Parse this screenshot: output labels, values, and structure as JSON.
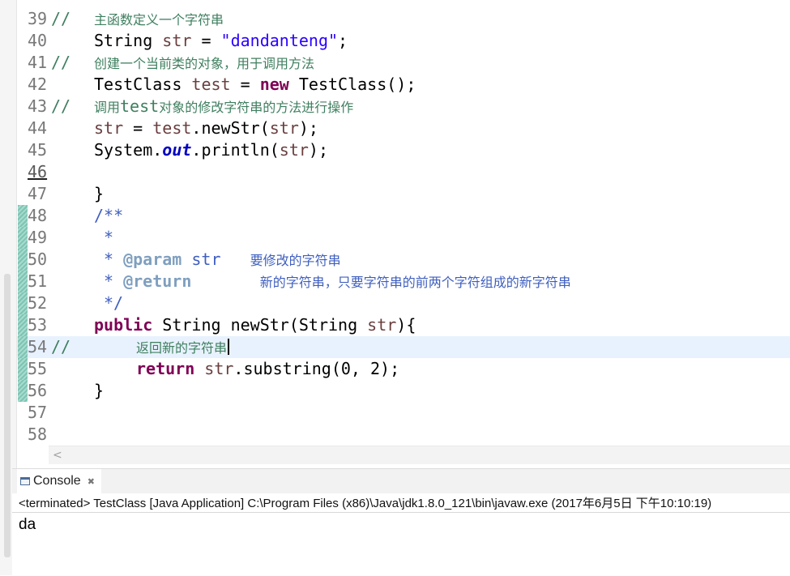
{
  "editor": {
    "lines": [
      {
        "num": "39",
        "comment_marker": "//",
        "tokens": [
          {
            "text": "主函数定义一个字符串",
            "color": "#3f7f5f",
            "cn": true,
            "indent": 116
          }
        ]
      },
      {
        "num": "40",
        "tokens": [
          {
            "text": "String ",
            "color": "#000000",
            "indent": 116
          },
          {
            "text": "str",
            "color": "#6a3e3e"
          },
          {
            "text": " = ",
            "color": "#000000"
          },
          {
            "text": "\"dandanteng\"",
            "color": "#2a00ff"
          },
          {
            "text": ";",
            "color": "#000000"
          }
        ]
      },
      {
        "num": "41",
        "comment_marker": "//",
        "tokens": [
          {
            "text": "创建一个当前类的对象，用于调用方法",
            "color": "#3f7f5f",
            "cn": true,
            "indent": 116
          }
        ]
      },
      {
        "num": "42",
        "tokens": [
          {
            "text": "TestClass ",
            "color": "#000000",
            "indent": 116
          },
          {
            "text": "test",
            "color": "#6a3e3e"
          },
          {
            "text": " = ",
            "color": "#000000"
          },
          {
            "text": "new",
            "color": "#7f0055",
            "bold": true
          },
          {
            "text": " TestClass();",
            "color": "#000000"
          }
        ]
      },
      {
        "num": "43",
        "comment_marker": "//",
        "tokens": [
          {
            "text": "调用",
            "color": "#3f7f5f",
            "cn": true,
            "indent": 116
          },
          {
            "text": "test",
            "color": "#3f7f5f"
          },
          {
            "text": "对象的修改字符串的方法进行操作",
            "color": "#3f7f5f",
            "cn": true
          }
        ]
      },
      {
        "num": "44",
        "tokens": [
          {
            "text": "str",
            "color": "#6a3e3e",
            "indent": 116
          },
          {
            "text": " = ",
            "color": "#000000"
          },
          {
            "text": "test",
            "color": "#6a3e3e"
          },
          {
            "text": ".newStr(",
            "color": "#000000"
          },
          {
            "text": "str",
            "color": "#6a3e3e"
          },
          {
            "text": ");",
            "color": "#000000"
          }
        ]
      },
      {
        "num": "45",
        "tokens": [
          {
            "text": "System.",
            "color": "#000000",
            "indent": 116
          },
          {
            "text": "out",
            "color": "#0000c0",
            "bold": true,
            "italic": true
          },
          {
            "text": ".println(",
            "color": "#000000"
          },
          {
            "text": "str",
            "color": "#6a3e3e"
          },
          {
            "text": ");",
            "color": "#000000"
          }
        ]
      },
      {
        "num": "46",
        "underline": true,
        "tokens": []
      },
      {
        "num": "47",
        "tokens": [
          {
            "text": "}",
            "color": "#000000",
            "indent": 116
          }
        ]
      },
      {
        "num": "48",
        "marker": true,
        "tokens": [
          {
            "text": "/**",
            "color": "#3f5fbf",
            "indent": 116
          }
        ]
      },
      {
        "num": "49",
        "marker": true,
        "tokens": [
          {
            "text": "*",
            "color": "#3f5fbf",
            "indent": 128
          }
        ]
      },
      {
        "num": "50",
        "marker": true,
        "tokens": [
          {
            "text": "* ",
            "color": "#3f5fbf",
            "indent": 128
          },
          {
            "text": "@param",
            "color": "#7f9fbf",
            "bold": true
          },
          {
            "text": " str   ",
            "color": "#3f5fbf"
          },
          {
            "text": "要修改的字符串",
            "color": "#3f5fbf",
            "cn": true
          }
        ]
      },
      {
        "num": "51",
        "marker": true,
        "tokens": [
          {
            "text": "* ",
            "color": "#3f5fbf",
            "indent": 128
          },
          {
            "text": "@return",
            "color": "#7f9fbf",
            "bold": true
          },
          {
            "text": "       ",
            "color": "#3f5fbf"
          },
          {
            "text": "新的字符串，只要字符串的前两个字符组成的新字符串",
            "color": "#3f5fbf",
            "cn": true
          }
        ]
      },
      {
        "num": "52",
        "marker": true,
        "tokens": [
          {
            "text": "*/",
            "color": "#3f5fbf",
            "indent": 128
          }
        ]
      },
      {
        "num": "53",
        "marker": true,
        "tokens": [
          {
            "text": "public",
            "color": "#7f0055",
            "bold": true,
            "indent": 116
          },
          {
            "text": " String newStr(String ",
            "color": "#000000"
          },
          {
            "text": "str",
            "color": "#6a3e3e"
          },
          {
            "text": "){",
            "color": "#000000"
          }
        ]
      },
      {
        "num": "54",
        "marker": true,
        "current": true,
        "caret": true,
        "comment_marker": "//",
        "tokens": [
          {
            "text": "返回新的字符串",
            "color": "#3f7f5f",
            "cn": true,
            "indent": 168
          }
        ]
      },
      {
        "num": "55",
        "marker": true,
        "tokens": [
          {
            "text": "return",
            "color": "#7f0055",
            "bold": true,
            "indent": 168
          },
          {
            "text": " ",
            "color": "#000000"
          },
          {
            "text": "str",
            "color": "#6a3e3e"
          },
          {
            "text": ".substring(0, 2);",
            "color": "#000000"
          }
        ]
      },
      {
        "num": "56",
        "marker": true,
        "tokens": [
          {
            "text": "}",
            "color": "#000000",
            "indent": 116
          }
        ]
      },
      {
        "num": "57",
        "tokens": []
      },
      {
        "num": "58",
        "tokens": []
      }
    ],
    "scroll_left_arrow": "<"
  },
  "console": {
    "tab_label": "Console",
    "tab_icon": "console-icon",
    "close_icon": "✖",
    "status": "<terminated> TestClass [Java Application] C:\\Program Files (x86)\\Java\\jdk1.8.0_121\\bin\\javaw.exe (2017年6月5日 下午10:10:19)",
    "output": "da"
  },
  "colors": {
    "comment": "#3f7f5f",
    "keyword": "#7f0055",
    "string": "#2a00ff",
    "local_variable": "#6a3e3e",
    "static_field": "#0000c0",
    "javadoc": "#3f5fbf",
    "javadoc_tag": "#7f9fbf",
    "current_line": "#e8f2fe",
    "change_marker": "#7ec4b3"
  }
}
